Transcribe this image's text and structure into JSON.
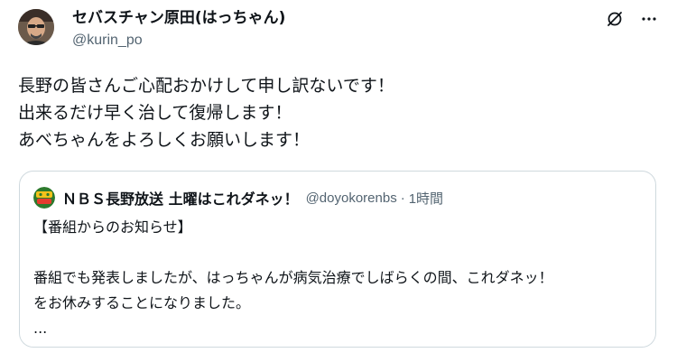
{
  "author": {
    "display_name": "セバスチャン原田(はっちゃん)",
    "handle": "@kurin_po"
  },
  "tweet": {
    "lines": [
      "長野の皆さんご心配おかけして申し訳ないです！",
      "出来るだけ早く治して復帰します！",
      "あべちゃんをよろしくお願いします！"
    ]
  },
  "quoted": {
    "display_name": "ＮＢＳ長野放送 土曜はこれダネッ！",
    "handle": "@doyokorenbs",
    "separator": "·",
    "time": "1時間",
    "lines": [
      "【番組からのお知らせ】",
      "",
      "番組でも発表しましたが、はっちゃんが病気治療でしばらくの間、これダネッ！",
      "をお休みすることになりました。",
      "..."
    ]
  },
  "icons": {
    "grok": "grok-icon",
    "more": "more-icon"
  },
  "colors": {
    "text": "#0f1419",
    "secondary": "#536471",
    "border": "#cfd9de",
    "quote_avatar_bg": "#2d7a2d",
    "quote_avatar_accent": "#f4c21b"
  }
}
